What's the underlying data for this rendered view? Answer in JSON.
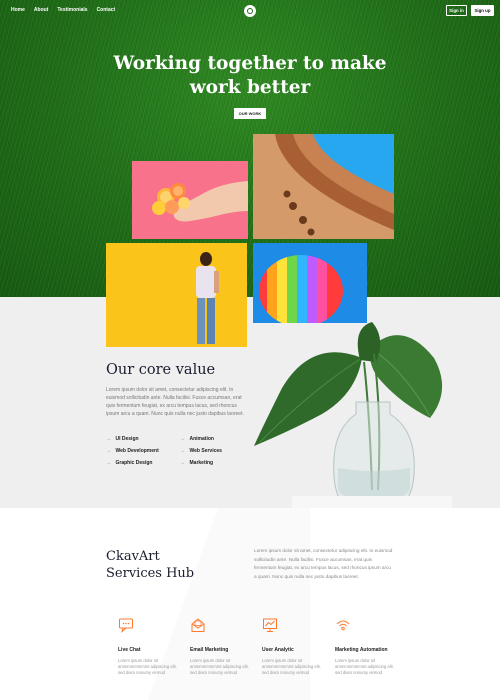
{
  "nav": {
    "links": [
      "Home",
      "About",
      "Testimonials",
      "Contact"
    ],
    "sign_in": "Sign in",
    "sign_up": "Sign up"
  },
  "hero": {
    "title_line1": "Working together to make",
    "title_line2": "work better",
    "cta": "OUR WORK"
  },
  "core": {
    "title": "Our core value",
    "text": "Lorem ipsum dolor sit amet, consectetur adipiscing elit. In euismod sollicitudin ante. Nulla facilisi. Fusce accumsan, erat quis fermentum feugiat, ex arcu tempus lacus, sed rhoncus ipsum arcu a quam. Nunc quis nulla nec justo dapibus laoreet.",
    "values": [
      "UI Design",
      "Animation",
      "Web Development",
      "Web Services",
      "Graphic Design",
      "Marketing"
    ]
  },
  "services": {
    "title_line1": "CkavArt",
    "title_line2": "Services Hub",
    "desc": "Lorem ipsum dolor sit amet, consectetur adipiscing elit. In euismod sollicitudin ante. Nulla facilisi. Fusce accumsan, erat quis fermentum feugiat, ex arcu tempus lacus, sed rhoncus ipsum arcu a quam. Nunc quis nulla nec justo dapibus laoreet.",
    "cards": [
      {
        "name": "Live Chat",
        "icon": "chat-icon",
        "text": "Lorem ipsum dolor sit ammmmmmmmt adipiscing elit. sed diam nonumy eirmod"
      },
      {
        "name": "Email Marketing",
        "icon": "email-icon",
        "text": "Lorem ipsum dolor sit ammmmmmmmt adipiscing elit. sed diam nonumy eirmod"
      },
      {
        "name": "User Analytic",
        "icon": "analytics-icon",
        "text": "Lorem ipsum dolor sit ammmmmmmmt adipiscing elit. sed diam nonumy eirmod"
      },
      {
        "name": "Marketing Automation",
        "icon": "signal-icon",
        "text": "Lorem ipsum dolor sit ammmmmmmmt adipiscing elit. sed diam nonumy eirmod"
      }
    ]
  },
  "colors": {
    "accent": "#ff7a2f",
    "hero_green": "#1f6e17",
    "dark_text": "#1a1d2e"
  }
}
